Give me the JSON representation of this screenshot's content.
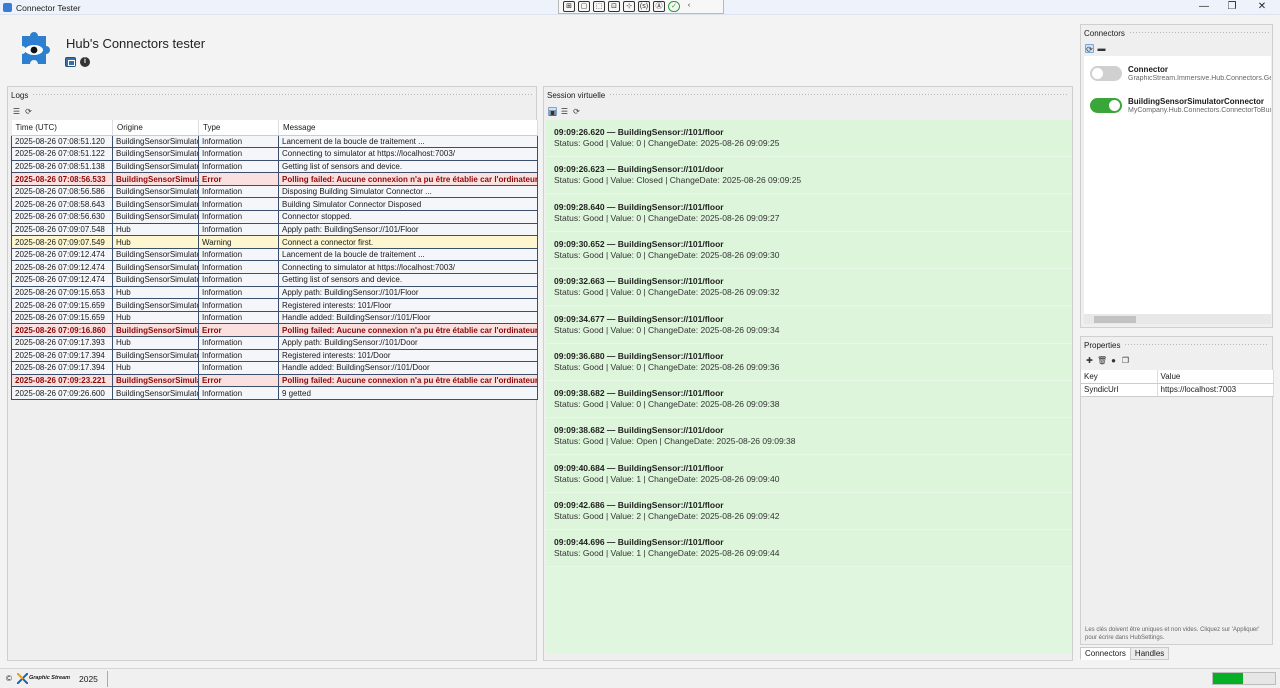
{
  "window": {
    "title": "Connector Tester",
    "controls": {
      "minimize": "—",
      "maximize": "❐",
      "close": "✕"
    }
  },
  "debug_toolbar": {
    "icons": [
      "live-visual-tree-icon",
      "select-element-icon",
      "display-layout-adorners-icon",
      "track-focus-icon",
      "hot-reload-icon",
      "binding-failures-icon",
      "accessibility-icon",
      "checkmark-icon",
      "collapse-icon"
    ],
    "labels": [
      "⊞",
      "▢",
      "⬚",
      "⊡",
      "⊹",
      "(s)",
      "Ⓐ",
      "✓",
      "‹"
    ]
  },
  "header": {
    "title": "Hub's Connectors tester",
    "info_glyph": "i"
  },
  "logs": {
    "title": "Logs",
    "toolbar": [
      "☰",
      "⟳"
    ],
    "columns": [
      "Time (UTC)",
      "Origine",
      "Type",
      "Message"
    ],
    "rows": [
      {
        "time": "2025-08-26 07:08:51.120",
        "origin": "BuildingSensorSimulator",
        "type": "Information",
        "message": "Lancement de la boucle de traitement ...",
        "level": "info"
      },
      {
        "time": "2025-08-26 07:08:51.122",
        "origin": "BuildingSensorSimulator",
        "type": "Information",
        "message": "Connecting to simulator at https://localhost:7003/",
        "level": "info"
      },
      {
        "time": "2025-08-26 07:08:51.138",
        "origin": "BuildingSensorSimulator",
        "type": "Information",
        "message": "Getting list of sensors and device.",
        "level": "info"
      },
      {
        "time": "2025-08-26 07:08:56.533",
        "origin": "BuildingSensorSimulator",
        "type": "Error",
        "message": "Polling failed: Aucune connexion n'a pu être établie car l'ordinateur cible",
        "level": "error"
      },
      {
        "time": "2025-08-26 07:08:56.586",
        "origin": "BuildingSensorSimulator",
        "type": "Information",
        "message": "Disposing Building Simulator Connector ...",
        "level": "info"
      },
      {
        "time": "2025-08-26 07:08:58.643",
        "origin": "BuildingSensorSimulator",
        "type": "Information",
        "message": "Building Simulator Connector Disposed",
        "level": "info"
      },
      {
        "time": "2025-08-26 07:08:56.630",
        "origin": "BuildingSensorSimulator",
        "type": "Information",
        "message": "Connector stopped.",
        "level": "info"
      },
      {
        "time": "2025-08-26 07:09:07.548",
        "origin": "Hub",
        "type": "Information",
        "message": "Apply path: BuildingSensor://101/Floor",
        "level": "info"
      },
      {
        "time": "2025-08-26 07:09:07.549",
        "origin": "Hub",
        "type": "Warning",
        "message": "Connect a connector first.",
        "level": "warning"
      },
      {
        "time": "2025-08-26 07:09:12.474",
        "origin": "BuildingSensorSimulator",
        "type": "Information",
        "message": "Lancement de la boucle de traitement ...",
        "level": "info"
      },
      {
        "time": "2025-08-26 07:09:12.474",
        "origin": "BuildingSensorSimulator",
        "type": "Information",
        "message": "Connecting to simulator at https://localhost:7003/",
        "level": "info"
      },
      {
        "time": "2025-08-26 07:09:12.474",
        "origin": "BuildingSensorSimulator",
        "type": "Information",
        "message": "Getting list of sensors and device.",
        "level": "info"
      },
      {
        "time": "2025-08-26 07:09:15.653",
        "origin": "Hub",
        "type": "Information",
        "message": "Apply path: BuildingSensor://101/Floor",
        "level": "info"
      },
      {
        "time": "2025-08-26 07:09:15.659",
        "origin": "BuildingSensorSimulator",
        "type": "Information",
        "message": "Registered interests: 101/Floor",
        "level": "info"
      },
      {
        "time": "2025-08-26 07:09:15.659",
        "origin": "Hub",
        "type": "Information",
        "message": "Handle added: BuildingSensor://101/Floor",
        "level": "info"
      },
      {
        "time": "2025-08-26 07:09:16.860",
        "origin": "BuildingSensorSimulator",
        "type": "Error",
        "message": "Polling failed: Aucune connexion n'a pu être établie car l'ordinateur cible",
        "level": "error"
      },
      {
        "time": "2025-08-26 07:09:17.393",
        "origin": "Hub",
        "type": "Information",
        "message": "Apply path: BuildingSensor://101/Door",
        "level": "info"
      },
      {
        "time": "2025-08-26 07:09:17.394",
        "origin": "BuildingSensorSimulator",
        "type": "Information",
        "message": "Registered interests: 101/Door",
        "level": "info"
      },
      {
        "time": "2025-08-26 07:09:17.394",
        "origin": "Hub",
        "type": "Information",
        "message": "Handle added: BuildingSensor://101/Door",
        "level": "info"
      },
      {
        "time": "2025-08-26 07:09:23.221",
        "origin": "BuildingSensorSimulator",
        "type": "Error",
        "message": "Polling failed: Aucune connexion n'a pu être établie car l'ordinateur cible",
        "level": "error"
      },
      {
        "time": "2025-08-26 07:09:26.600",
        "origin": "BuildingSensorSimulator",
        "type": "Information",
        "message": "9 getted",
        "level": "info"
      }
    ]
  },
  "session": {
    "title": "Session virtuelle",
    "toolbar": [
      "▣",
      "☰",
      "⟳"
    ],
    "events": [
      {
        "title": "09:09:26.620  —  BuildingSensor://101/floor",
        "detail": "Status: Good   |  Value: 0   |  ChangeDate: 2025-08-26 09:09:25"
      },
      {
        "title": "09:09:26.623  —  BuildingSensor://101/door",
        "detail": "Status: Good   |  Value: Closed   |  ChangeDate: 2025-08-26 09:09:25"
      },
      {
        "title": "09:09:28.640  —  BuildingSensor://101/floor",
        "detail": "Status: Good   |  Value: 0   |  ChangeDate: 2025-08-26 09:09:27"
      },
      {
        "title": "09:09:30.652  —  BuildingSensor://101/floor",
        "detail": "Status: Good   |  Value: 0   |  ChangeDate: 2025-08-26 09:09:30"
      },
      {
        "title": "09:09:32.663  —  BuildingSensor://101/floor",
        "detail": "Status: Good   |  Value: 0   |  ChangeDate: 2025-08-26 09:09:32"
      },
      {
        "title": "09:09:34.677  —  BuildingSensor://101/floor",
        "detail": "Status: Good   |  Value: 0   |  ChangeDate: 2025-08-26 09:09:34"
      },
      {
        "title": "09:09:36.680  —  BuildingSensor://101/floor",
        "detail": "Status: Good   |  Value: 0   |  ChangeDate: 2025-08-26 09:09:36"
      },
      {
        "title": "09:09:38.682  —  BuildingSensor://101/floor",
        "detail": "Status: Good   |  Value: 0   |  ChangeDate: 2025-08-26 09:09:38"
      },
      {
        "title": "09:09:38.682  —  BuildingSensor://101/door",
        "detail": "Status: Good   |  Value: Open   |  ChangeDate: 2025-08-26 09:09:38"
      },
      {
        "title": "09:09:40.684  —  BuildingSensor://101/floor",
        "detail": "Status: Good   |  Value: 1   |  ChangeDate: 2025-08-26 09:09:40"
      },
      {
        "title": "09:09:42.686  —  BuildingSensor://101/floor",
        "detail": "Status: Good   |  Value: 2   |  ChangeDate: 2025-08-26 09:09:42"
      },
      {
        "title": "09:09:44.696  —  BuildingSensor://101/floor",
        "detail": "Status: Good   |  Value: 1   |  ChangeDate: 2025-08-26 09:09:44"
      }
    ]
  },
  "connectors": {
    "title": "Connectors",
    "toolbar": [
      "⟳",
      "▬"
    ],
    "items": [
      {
        "name": "Connector",
        "type": "GraphicStream.Immersive.Hub.Connectors.GenericConnector",
        "enabled": false
      },
      {
        "name": "BuildingSensorSimulatorConnector",
        "type": "MyCompany.Hub.Connectors.ConnectorToBuildingSensor",
        "enabled": true
      }
    ]
  },
  "properties": {
    "title": "Properties",
    "toolbar": [
      "✚",
      "🗑",
      "●",
      "❐"
    ],
    "columns": [
      "Key",
      "Value"
    ],
    "rows": [
      {
        "key": "SyndicUrl",
        "value": "https://localhost:7003"
      }
    ],
    "hint": "Les clés doivent être uniques et non vides. Cliquez sur 'Appliquer' pour écrire dans HubSettings."
  },
  "tabs": [
    {
      "label": "Connectors",
      "active": true
    },
    {
      "label": "Handles",
      "active": false
    }
  ],
  "status_bar": {
    "copyright": "©",
    "brand": "Graphic Stream",
    "year": "2025",
    "progress": 0.48
  },
  "colors": {
    "error_bg": "#fbe0e0",
    "warning_bg": "#fdf6cf",
    "event_bg": "#ddf5da",
    "toggle_on": "#3aa63a",
    "progress": "#06b025"
  }
}
